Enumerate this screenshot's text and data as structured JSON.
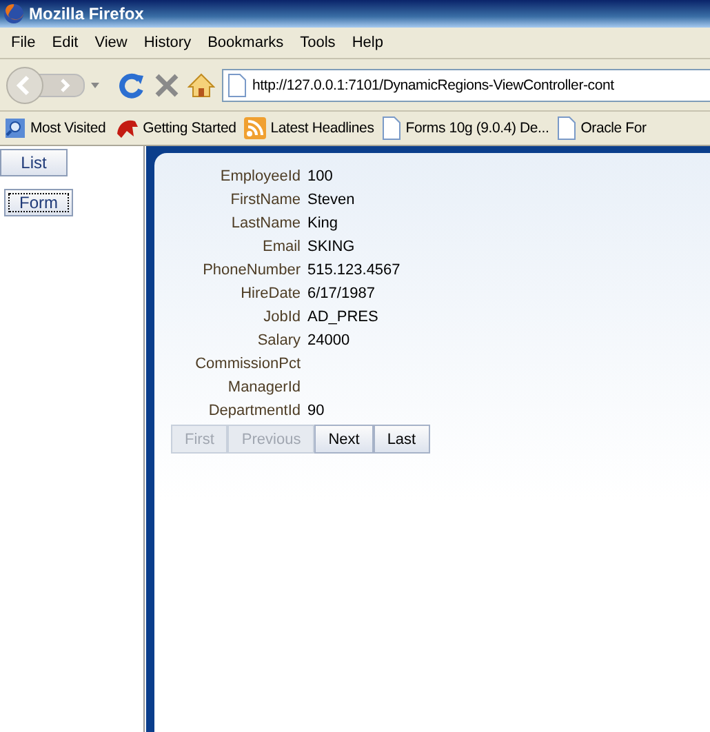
{
  "window": {
    "title": "Mozilla Firefox"
  },
  "menu": [
    "File",
    "Edit",
    "View",
    "History",
    "Bookmarks",
    "Tools",
    "Help"
  ],
  "address": {
    "value": "http://127.0.0.1:7101/DynamicRegions-ViewController-cont"
  },
  "bookmarks": [
    {
      "label": "Most Visited",
      "kind": "search"
    },
    {
      "label": "Getting Started",
      "kind": "creature"
    },
    {
      "label": "Latest Headlines",
      "kind": "feed"
    },
    {
      "label": "Forms 10g (9.0.4) De...",
      "kind": "page"
    },
    {
      "label": "Oracle For",
      "kind": "page"
    }
  ],
  "side_buttons": [
    {
      "label": "List",
      "focused": false
    },
    {
      "label": "Form",
      "focused": true
    }
  ],
  "fields": [
    {
      "label": "EmployeeId",
      "value": "100"
    },
    {
      "label": "FirstName",
      "value": "Steven"
    },
    {
      "label": "LastName",
      "value": "King"
    },
    {
      "label": "Email",
      "value": "SKING"
    },
    {
      "label": "PhoneNumber",
      "value": "515.123.4567"
    },
    {
      "label": "HireDate",
      "value": "6/17/1987"
    },
    {
      "label": "JobId",
      "value": "AD_PRES"
    },
    {
      "label": "Salary",
      "value": "24000"
    },
    {
      "label": "CommissionPct"
    },
    {
      "label": "ManagerId"
    },
    {
      "label": "DepartmentId",
      "value": "90"
    }
  ],
  "pager": [
    {
      "label": "First",
      "disabled": true
    },
    {
      "label": "Previous",
      "disabled": true
    },
    {
      "label": "Next",
      "disabled": false
    },
    {
      "label": "Last",
      "disabled": false
    }
  ]
}
